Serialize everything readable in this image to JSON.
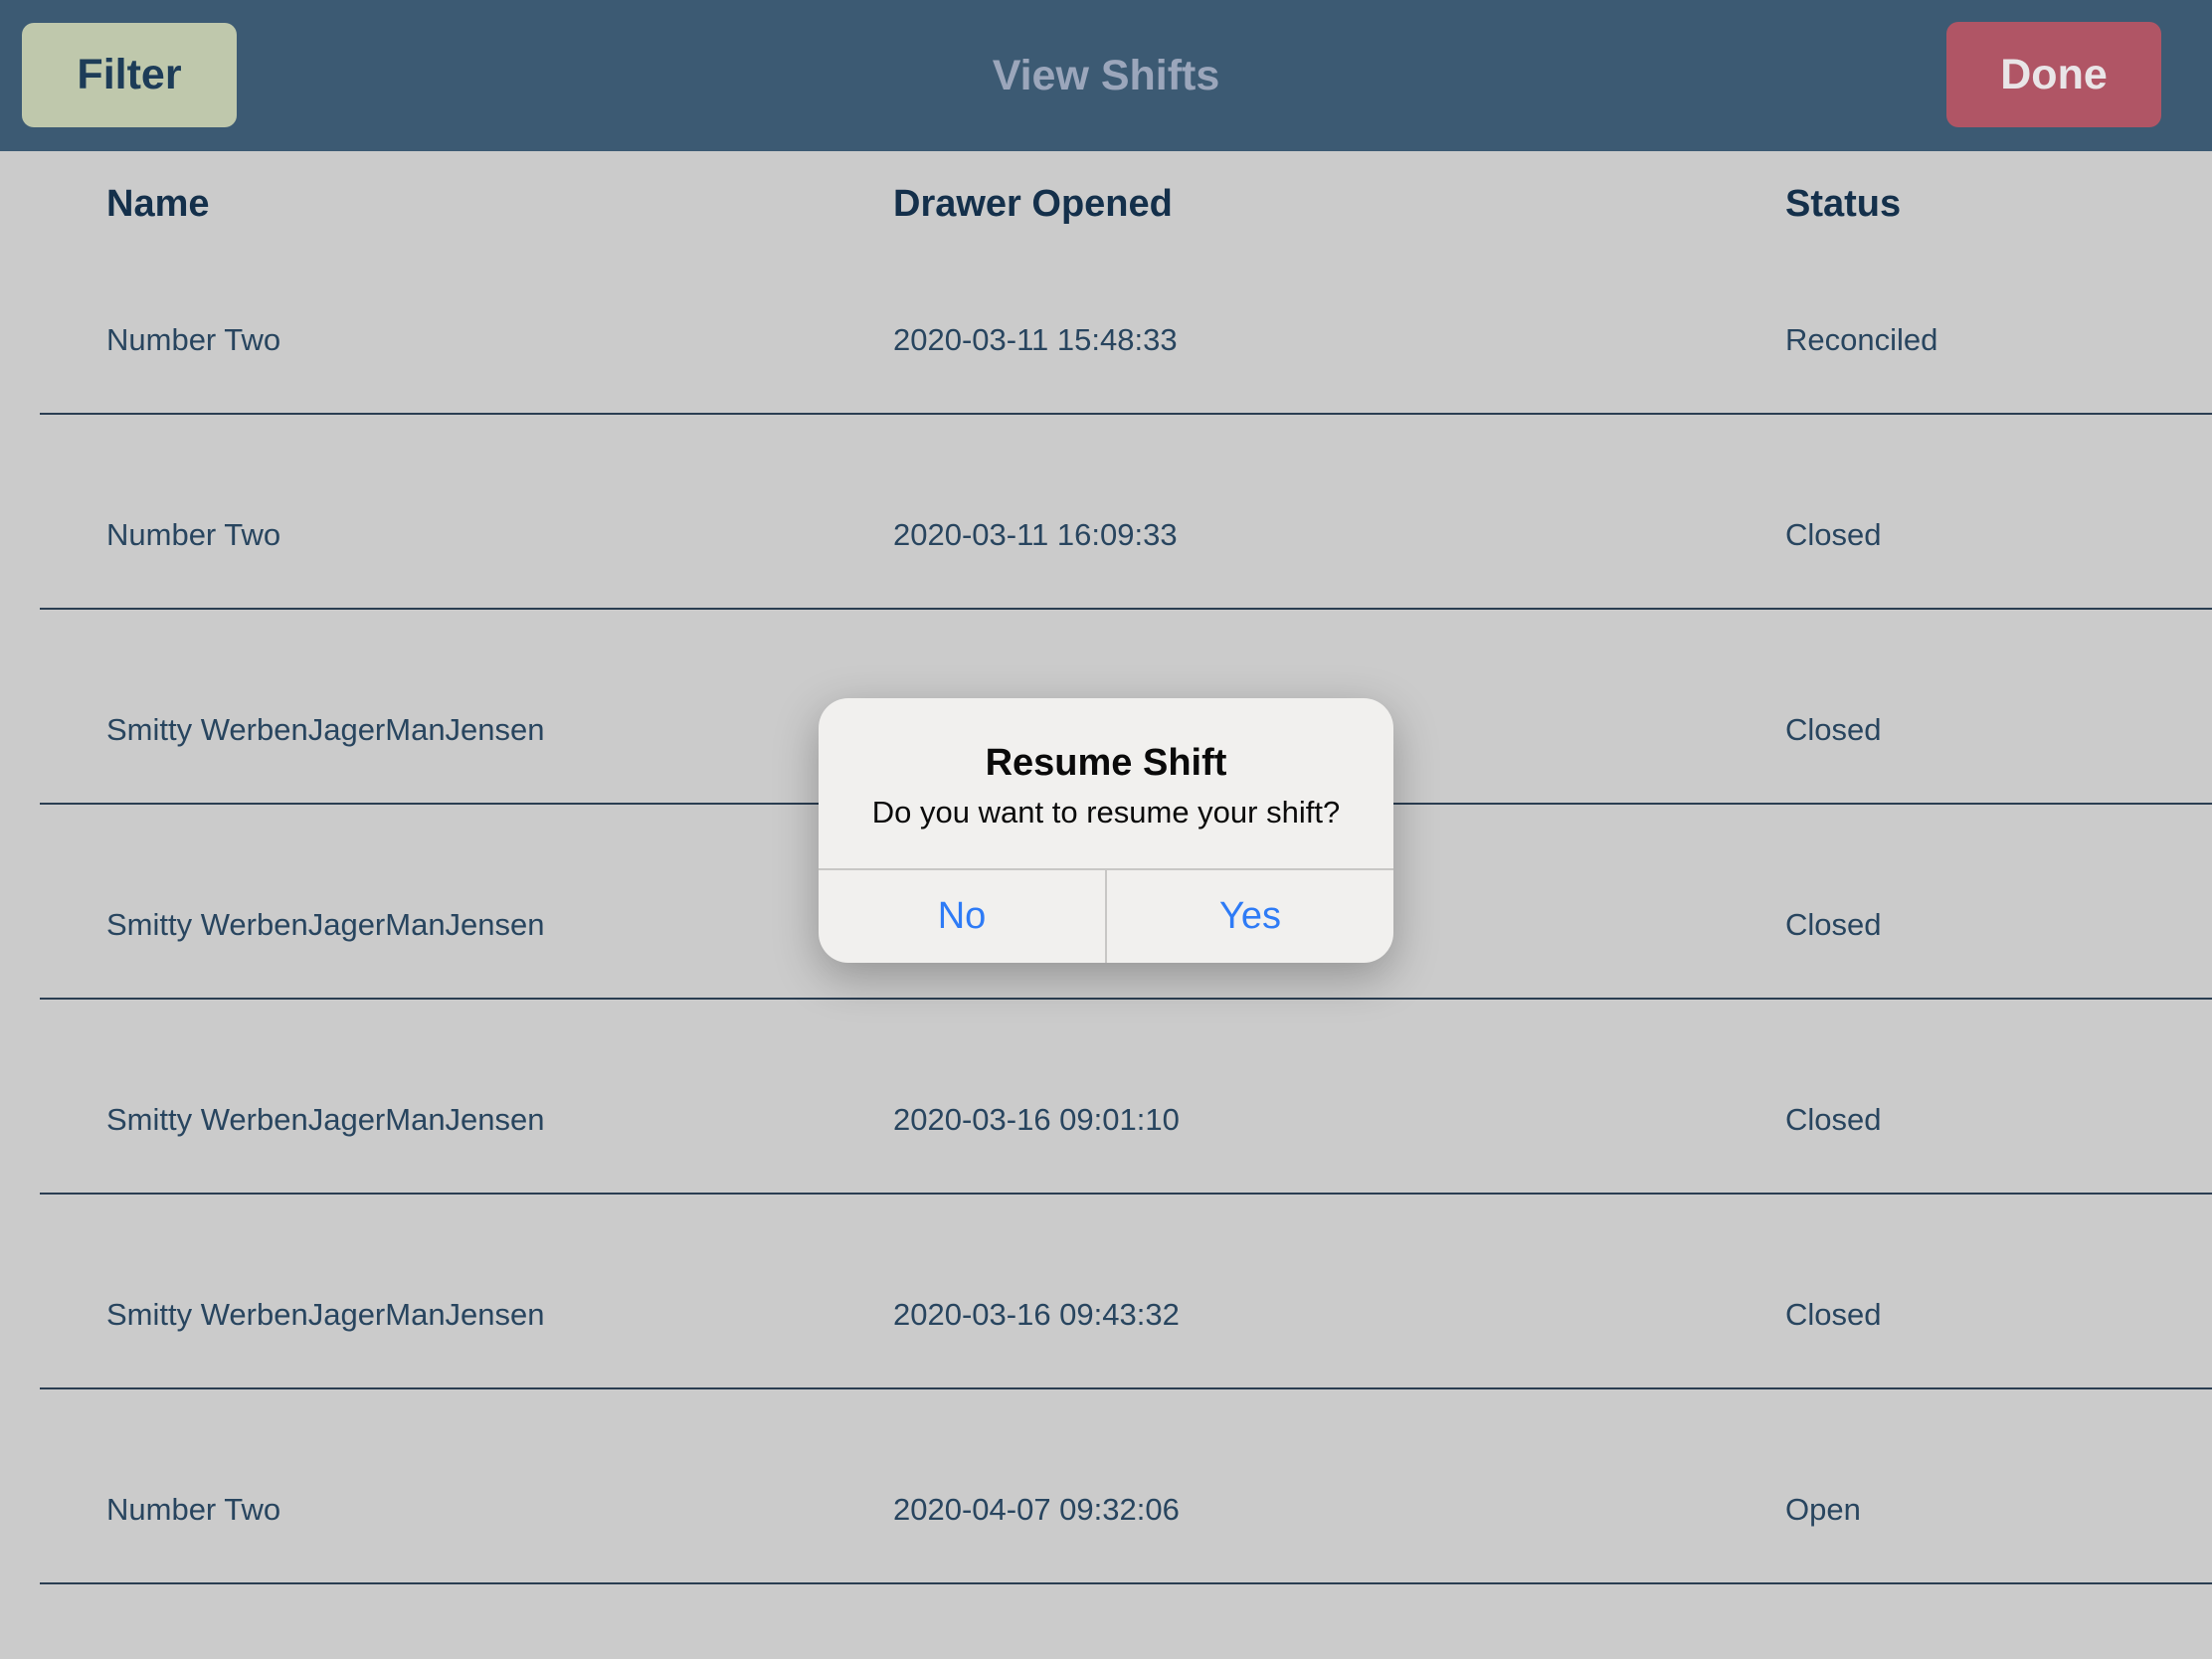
{
  "navbar": {
    "filter_label": "Filter",
    "title": "View Shifts",
    "done_label": "Done"
  },
  "table": {
    "columns": [
      "Name",
      "Drawer Opened",
      "Status"
    ],
    "rows": [
      {
        "name": "Number Two",
        "drawer_opened": "2020-03-11 15:48:33",
        "status": "Reconciled"
      },
      {
        "name": "Number Two",
        "drawer_opened": "2020-03-11 16:09:33",
        "status": "Closed"
      },
      {
        "name": "Smitty WerbenJagerManJensen",
        "drawer_opened": "",
        "status": "Closed"
      },
      {
        "name": "Smitty WerbenJagerManJensen",
        "drawer_opened": "",
        "status": "Closed"
      },
      {
        "name": "Smitty WerbenJagerManJensen",
        "drawer_opened": "2020-03-16 09:01:10",
        "status": "Closed"
      },
      {
        "name": "Smitty WerbenJagerManJensen",
        "drawer_opened": "2020-03-16 09:43:32",
        "status": "Closed"
      },
      {
        "name": "Number Two",
        "drawer_opened": "2020-04-07 09:32:06",
        "status": "Open"
      }
    ]
  },
  "dialog": {
    "title": "Resume Shift",
    "message": "Do you want to resume your shift?",
    "no_label": "No",
    "yes_label": "Yes"
  },
  "colors": {
    "navbar_bg": "#3c5a73",
    "filter_button_bg": "#bfc8ac",
    "done_button_bg": "#b05565",
    "page_bg": "#cbcbcb",
    "header_text": "#14304b",
    "row_text": "#28455f",
    "separator": "#2b3e52",
    "alert_bg": "#f1f0ee",
    "alert_action_blue": "#2e7bf6"
  }
}
